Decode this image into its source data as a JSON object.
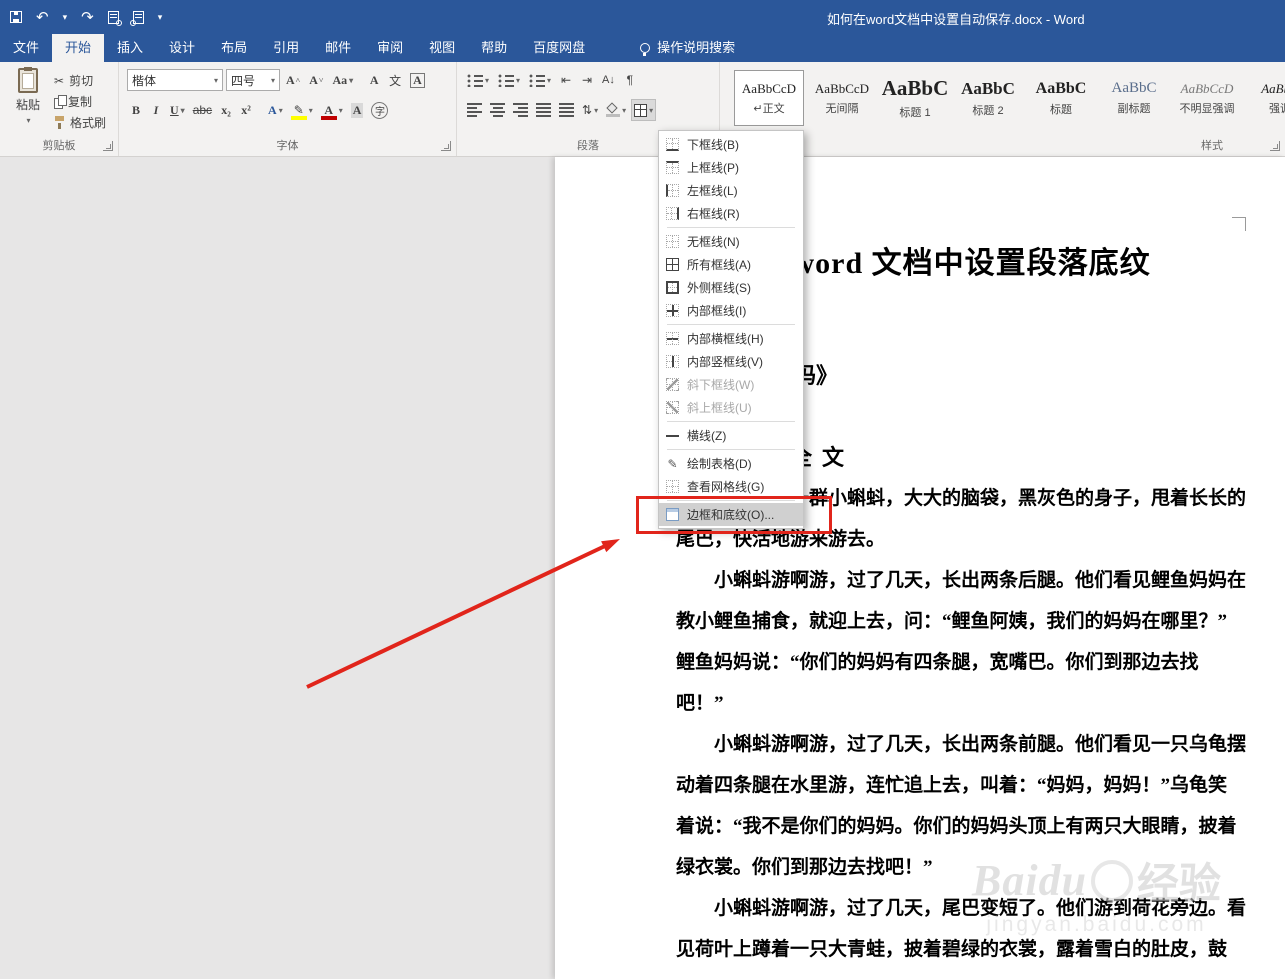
{
  "titlebar": {
    "title": "如何在word文档中设置自动保存.docx - Word"
  },
  "tabs": {
    "items": [
      "文件",
      "开始",
      "插入",
      "设计",
      "布局",
      "引用",
      "邮件",
      "审阅",
      "视图",
      "帮助",
      "百度网盘"
    ],
    "active": "开始",
    "search_label": "操作说明搜索"
  },
  "glyphs": {
    "caret": "▾",
    "undo": "↶",
    "redo": "↷",
    "scissors": "✂",
    "pilcrow": "¶",
    "line_spacing": "⇅",
    "outdent": "⇤",
    "indent": "⇥",
    "sort": "A↓",
    "pencil": "✎"
  },
  "ribbon": {
    "clipboard": {
      "group_label": "剪贴板",
      "paste": "粘贴",
      "cut": "剪切",
      "copy": "复制",
      "format_painter": "格式刷"
    },
    "font": {
      "group_label": "字体",
      "font_name": "楷体",
      "font_size": "四号",
      "grow": "A",
      "shrink": "A",
      "change_case": "Aa",
      "clear": "A",
      "phonetic": "文",
      "char_border": "A",
      "bold": "B",
      "italic": "I",
      "underline": "U",
      "strikethrough": "abc",
      "subscript": "x₂",
      "superscript": "x²",
      "text_effects": "A",
      "font_color": "A",
      "char_shading": "A",
      "enclose": "字"
    },
    "paragraph": {
      "group_label": "段落"
    },
    "styles": {
      "group_label": "样式",
      "items": [
        {
          "sample": "AaBbCcD",
          "name": "↵正文"
        },
        {
          "sample": "AaBbCcD",
          "name": "无间隔"
        },
        {
          "sample": "AaBbC",
          "name": "标题 1"
        },
        {
          "sample": "AaBbC",
          "name": "标题 2"
        },
        {
          "sample": "AaBbC",
          "name": "标题"
        },
        {
          "sample": "AaBbC",
          "name": "副标题"
        },
        {
          "sample": "AaBbCcD",
          "name": "不明显强调"
        },
        {
          "sample": "AaBbC",
          "name": "强调"
        }
      ]
    }
  },
  "borders_menu": {
    "items": [
      {
        "label": "下框线(B)",
        "icon": "border-bottom-icon"
      },
      {
        "label": "上框线(P)",
        "icon": "border-top-icon"
      },
      {
        "label": "左框线(L)",
        "icon": "border-left-icon"
      },
      {
        "label": "右框线(R)",
        "icon": "border-right-icon"
      },
      {
        "label": "无框线(N)",
        "icon": "border-none-icon"
      },
      {
        "label": "所有框线(A)",
        "icon": "border-all-icon"
      },
      {
        "label": "外侧框线(S)",
        "icon": "border-outside-icon"
      },
      {
        "label": "内部框线(I)",
        "icon": "border-inside-icon"
      },
      {
        "label": "内部横框线(H)",
        "icon": "border-inside-horizontal-icon"
      },
      {
        "label": "内部竖框线(V)",
        "icon": "border-inside-vertical-icon"
      },
      {
        "label": "斜下框线(W)",
        "icon": "border-diagonal-down-icon",
        "disabled": true
      },
      {
        "label": "斜上框线(U)",
        "icon": "border-diagonal-up-icon",
        "disabled": true
      },
      {
        "label": "横线(Z)",
        "icon": "horizontal-line-icon"
      },
      {
        "label": "绘制表格(D)",
        "icon": "draw-table-icon"
      },
      {
        "label": "查看网格线(G)",
        "icon": "view-gridlines-icon"
      },
      {
        "label": "边框和底纹(O)...",
        "icon": "borders-and-shading-icon",
        "highlighted": true
      }
    ]
  },
  "document": {
    "title": "在 word 文档中设置段落底纹",
    "heading": "《小蝌蚪找妈妈》",
    "step": "选中全文",
    "lines": [
      "　　池塘里有一群小蝌蚪，大大的脑袋，黑灰色的身子，甩着长长的",
      "尾巴，快活地游来游去。",
      "　　小蝌蚪游啊游，过了几天，长出两条后腿。他们看见鲤鱼妈妈在",
      "教小鲤鱼捕食，就迎上去，问：“鲤鱼阿姨，我们的妈妈在哪里？”",
      "鲤鱼妈妈说：“你们的妈妈有四条腿，宽嘴巴。你们到那边去找",
      "吧！”",
      "　　小蝌蚪游啊游，过了几天，长出两条前腿。他们看见一只乌龟摆",
      "动着四条腿在水里游，连忙追上去，叫着：“妈妈，妈妈！”乌龟笑",
      "着说：“我不是你们的妈妈。你们的妈妈头顶上有两只大眼睛，披着",
      "绿衣裳。你们到那边去找吧！”",
      "　　小蝌蚪游啊游，过了几天，尾巴变短了。他们游到荷花旁边。看",
      "见荷叶上蹲着一只大青蛙，披着碧绿的衣裳，露着雪白的肚皮，鼓"
    ]
  },
  "watermark": {
    "brand": "Baidu",
    "brand_suffix": "经验",
    "url": "jingyan.baidu.com"
  },
  "colors": {
    "titlebar": "#2B579A",
    "annotation": "#E1251B",
    "highlight": "#FFFF00",
    "font_color_red": "#C00000"
  }
}
